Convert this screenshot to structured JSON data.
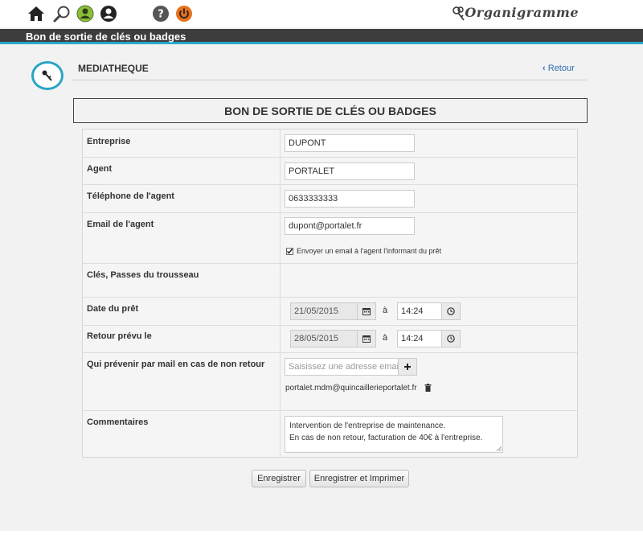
{
  "app": {
    "brand": "Organigramme"
  },
  "header": {
    "title": "Bon de sortie de clés ou badges"
  },
  "section": {
    "title": "MEDIATHEQUE",
    "back_label": "Retour"
  },
  "form": {
    "title": "BON DE SORTIE DE CLÉS OU BADGES",
    "entreprise": {
      "label": "Entreprise",
      "value": "DUPONT"
    },
    "agent": {
      "label": "Agent",
      "value": "PORTALET"
    },
    "telephone": {
      "label": "Téléphone de l'agent",
      "value": "0633333333"
    },
    "email": {
      "label": "Email de l'agent",
      "value": "dupont@portalet.fr",
      "notify_label": "Envoyer un email à l'agent l'informant du prêt",
      "notify_checked": true
    },
    "keys": {
      "label": "Clés, Passes du trousseau"
    },
    "loan_date": {
      "label": "Date du prêt",
      "date": "21/05/2015",
      "separator": "à",
      "time": "14:24"
    },
    "return_date": {
      "label": "Retour prévu le",
      "date": "28/05/2015",
      "separator": "à",
      "time": "14:24"
    },
    "notify_missing": {
      "label": "Qui prévenir par mail en cas de non retour",
      "placeholder": "Saisissez une adresse email",
      "emails": [
        "portalet.mdm@quincaillerieportalet.fr"
      ]
    },
    "comments": {
      "label": "Commentaires",
      "lines": [
        "Intervention de l'entreprise de maintenance.",
        "En cas de non retour, facturation de 40€ à l'entreprise."
      ]
    }
  },
  "actions": {
    "save_label": "Enregistrer",
    "save_print_label": "Enregistrer et Imprimer"
  },
  "icons": [
    "home-icon",
    "search-icon",
    "user-status-icon",
    "user-icon",
    "help-icon",
    "power-icon",
    "keys-icon",
    "calendar-icon",
    "clock-icon",
    "plus-icon",
    "trash-icon",
    "chevron-left-icon"
  ],
  "colors": {
    "accent": "#2aa7c9",
    "power": "#e8701a",
    "title_band": "#3d3d3d",
    "link": "#2a6fb0"
  }
}
